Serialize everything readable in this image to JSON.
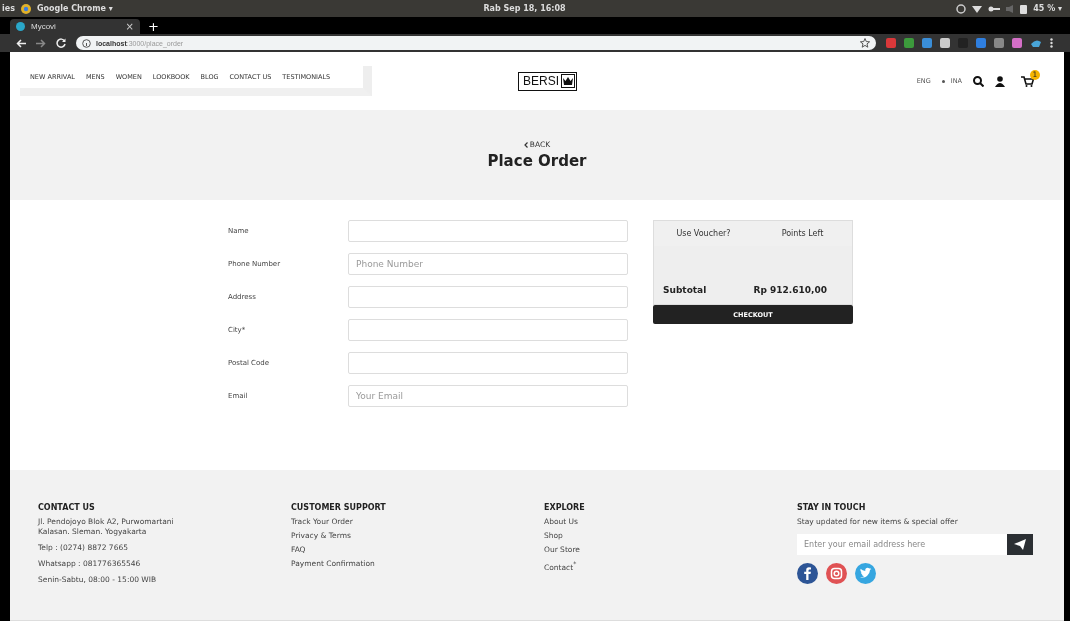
{
  "os_bar": {
    "activities": "ies",
    "app": "Google Chrome ▾",
    "clock": "Rab Sep 18, 16:08",
    "battery": "45 % ▾"
  },
  "browser": {
    "tab": {
      "title": "Mycovi",
      "close": "×"
    },
    "new_tab": "+",
    "url_host": "localhost",
    "url_path": ":3000/place_order"
  },
  "nav": {
    "items": [
      "NEW ARRIVAL",
      "MENS",
      "WOMEN",
      "LOOKBOOK",
      "BLOG",
      "CONTACT US",
      "TESTIMONIALS"
    ],
    "logo": "BERSI",
    "languages": [
      "ENG",
      "INA"
    ],
    "cart_count": "1"
  },
  "hero": {
    "back": "BACK",
    "title": "Place Order"
  },
  "form": {
    "fields": [
      {
        "label": "Name"
      },
      {
        "label": "Phone Number",
        "placeholder": "Phone Number"
      },
      {
        "label": "Address"
      },
      {
        "label": "City*"
      },
      {
        "label": "Postal Code"
      },
      {
        "label": "Email",
        "placeholder": "Your Email"
      }
    ]
  },
  "summary": {
    "tabs": [
      "Use Voucher?",
      "Points Left"
    ],
    "subtotal_label": "Subtotal",
    "subtotal_value": "Rp 912.610,00",
    "checkout": "CHECKOUT"
  },
  "footer": {
    "columns": [
      {
        "title": "CONTACT US",
        "lines": [
          "Jl. Pendojoyo Blok A2, Purwomartani\nKalasan. Sleman. Yogyakarta",
          "Telp : (0274) 8872 7665",
          "Whatsapp : 081776365546",
          "Senin-Sabtu, 08:00 - 15:00 WIB"
        ]
      },
      {
        "title": "CUSTOMER SUPPORT",
        "links": [
          "Track Your Order",
          "Privacy & Terms",
          "FAQ",
          "Payment Confirmation"
        ]
      },
      {
        "title": "EXPLORE",
        "links": [
          "About Us",
          "Shop",
          "Our Store",
          "Contact$^{*}$"
        ]
      },
      {
        "title": "STAY IN TOUCH",
        "text": "Stay updated for new items & special offer",
        "placeholder": "Enter your email address here"
      }
    ]
  }
}
